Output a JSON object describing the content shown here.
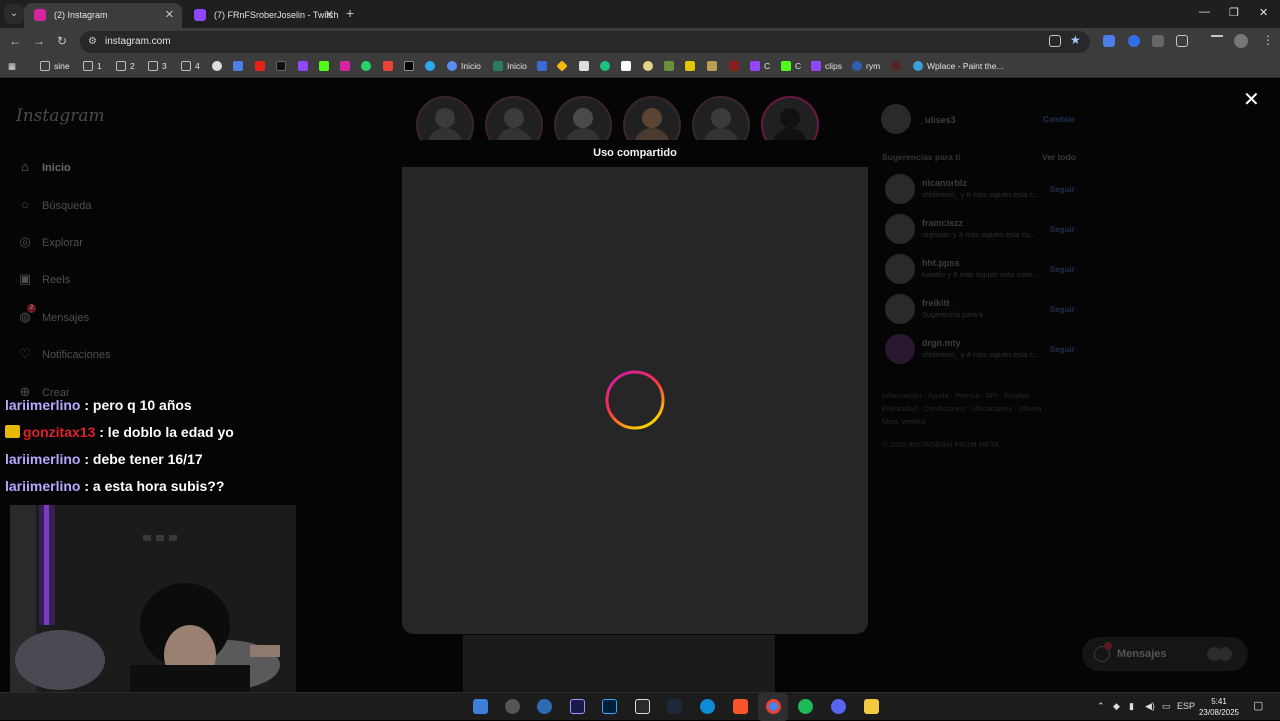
{
  "browser": {
    "tabs": [
      {
        "title": "(2) Instagram",
        "active": true
      },
      {
        "title": "(7) FRnFSroberJoselin - Twitch",
        "active": false
      }
    ],
    "url": "instagram.com",
    "bookmarks": [
      "sine",
      "1",
      "2",
      "3",
      "4",
      "Inicio",
      "Inicio",
      "C",
      "C",
      "clips",
      "rym",
      "Wplace - Paint the..."
    ]
  },
  "instagram": {
    "logo": "Instagram",
    "nav": [
      {
        "label": "Inicio",
        "icon": "home-icon"
      },
      {
        "label": "Búsqueda",
        "icon": "search-icon"
      },
      {
        "label": "Explorar",
        "icon": "compass-icon"
      },
      {
        "label": "Reels",
        "icon": "reels-icon"
      },
      {
        "label": "Mensajes",
        "icon": "messenger-icon",
        "badge": "2"
      },
      {
        "label": "Notificaciones",
        "icon": "heart-icon"
      },
      {
        "label": "Crear",
        "icon": "plus-icon"
      }
    ],
    "modal_title": "Uso compartido",
    "current_user": {
      "username": "_ulises3",
      "switch_label": "Cambiar"
    },
    "suggestions_title": "Sugerencias para ti",
    "see_all": "Ver todo",
    "suggestions": [
      {
        "username": "nicanorblz",
        "subtitle": "chhimnoo_ y 8 más siguen esta c...",
        "action": "Seguir"
      },
      {
        "username": "framciszz",
        "subtitle": "regisaan y 3 más siguen esta cu...",
        "action": "Seguir"
      },
      {
        "username": "hht.ppss",
        "subtitle": "kaattiiv y 8 más siguen esta cuen...",
        "action": "Seguir"
      },
      {
        "username": "freikitt",
        "subtitle": "Sugerencia para ti",
        "action": "Seguir"
      },
      {
        "username": "drgn.mty",
        "subtitle": "chhimnoo_ y 4 más siguen esta c...",
        "action": "Seguir"
      }
    ],
    "footer_line1": "Información · Ayuda · Prensa · API · Empleo ·",
    "footer_line2": "Privacidad · Condiciones · Ubicaciones · Idioma ·",
    "footer_line3": "Meta Verified",
    "copyright": "© 2025 INSTAGRAM FROM META",
    "messages_pill": {
      "label": "Mensajes",
      "badge": "2"
    }
  },
  "stream_chat": [
    {
      "user": "lariimerlino",
      "text": ": pero q 10 años",
      "color": "#b7a9ff"
    },
    {
      "user": "gonzitax13",
      "text": ": le doblo la edad yo",
      "color": "#e0202d",
      "crown": true
    },
    {
      "user": "lariimerlino",
      "text": ": debe tener 16/17",
      "color": "#b7a9ff"
    },
    {
      "user": "lariimerlino",
      "text": ": a esta hora subis??",
      "color": "#b7a9ff"
    }
  ],
  "taskbar": {
    "language": "ESP",
    "time": "5:41",
    "date": "23/08/2025"
  },
  "colors": {
    "modal_bg": "#262626",
    "spinner_gradient": [
      "#c913b9",
      "#f9373f",
      "#fecd00"
    ]
  }
}
